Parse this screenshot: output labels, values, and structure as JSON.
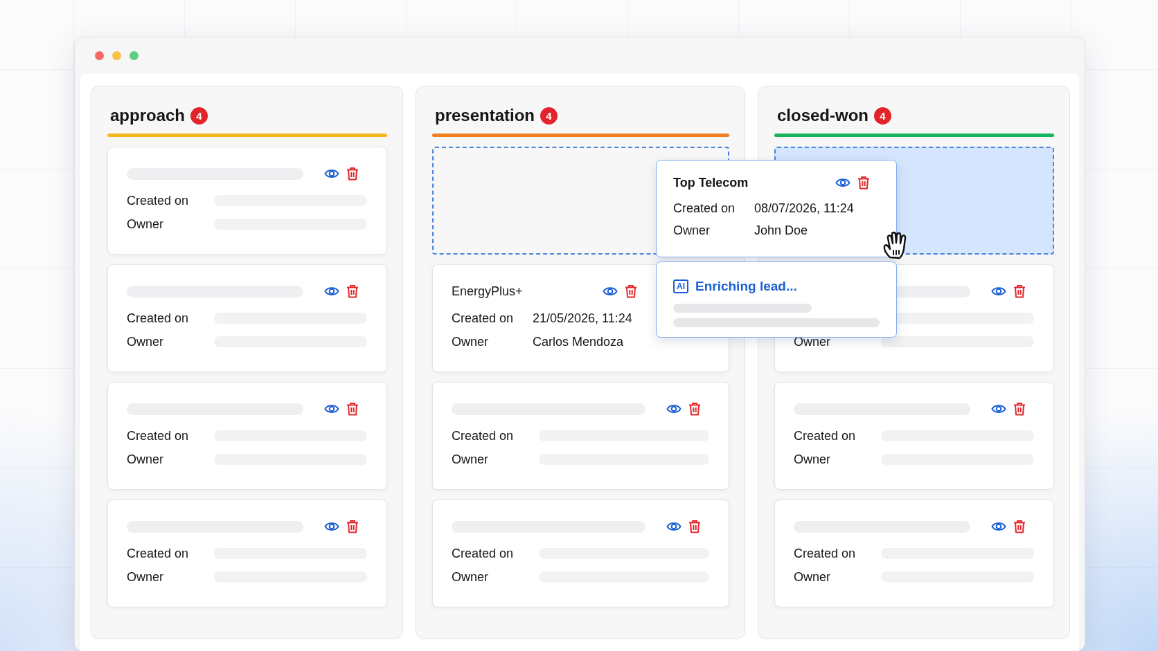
{
  "columns": [
    {
      "title": "approach",
      "count": "4",
      "color": "#f5b91e",
      "cards": [
        {
          "kind": "skeleton",
          "created_label": "Created on",
          "owner_label": "Owner"
        },
        {
          "kind": "skeleton",
          "created_label": "Created on",
          "owner_label": "Owner"
        },
        {
          "kind": "skeleton",
          "created_label": "Created on",
          "owner_label": "Owner"
        },
        {
          "kind": "skeleton",
          "created_label": "Created on",
          "owner_label": "Owner"
        }
      ]
    },
    {
      "title": "presentation",
      "count": "4",
      "color": "#f07f22",
      "cards": [
        {
          "kind": "drop-target",
          "highlighted": false
        },
        {
          "kind": "lead",
          "name": "EnergyPlus+",
          "created_label": "Created on",
          "created": "21/05/2026, 11:24",
          "owner_label": "Owner",
          "owner": "Carlos Mendoza"
        },
        {
          "kind": "skeleton",
          "created_label": "Created on",
          "owner_label": "Owner"
        },
        {
          "kind": "skeleton",
          "created_label": "Created on",
          "owner_label": "Owner"
        }
      ]
    },
    {
      "title": "closed-won",
      "count": "4",
      "color": "#17b35a",
      "cards": [
        {
          "kind": "drop-target",
          "highlighted": true
        },
        {
          "kind": "skeleton",
          "owner_label": "Owner"
        },
        {
          "kind": "skeleton",
          "created_label": "Created on",
          "owner_label": "Owner"
        },
        {
          "kind": "skeleton",
          "created_label": "Created on",
          "owner_label": "Owner"
        }
      ]
    }
  ],
  "dragged_card": {
    "name": "Top Telecom",
    "created_label": "Created on",
    "created": "08/07/2026, 11:24",
    "owner_label": "Owner",
    "owner": "John Doe"
  },
  "enrichment": {
    "badge": "AI",
    "label": "Enriching lead..."
  }
}
